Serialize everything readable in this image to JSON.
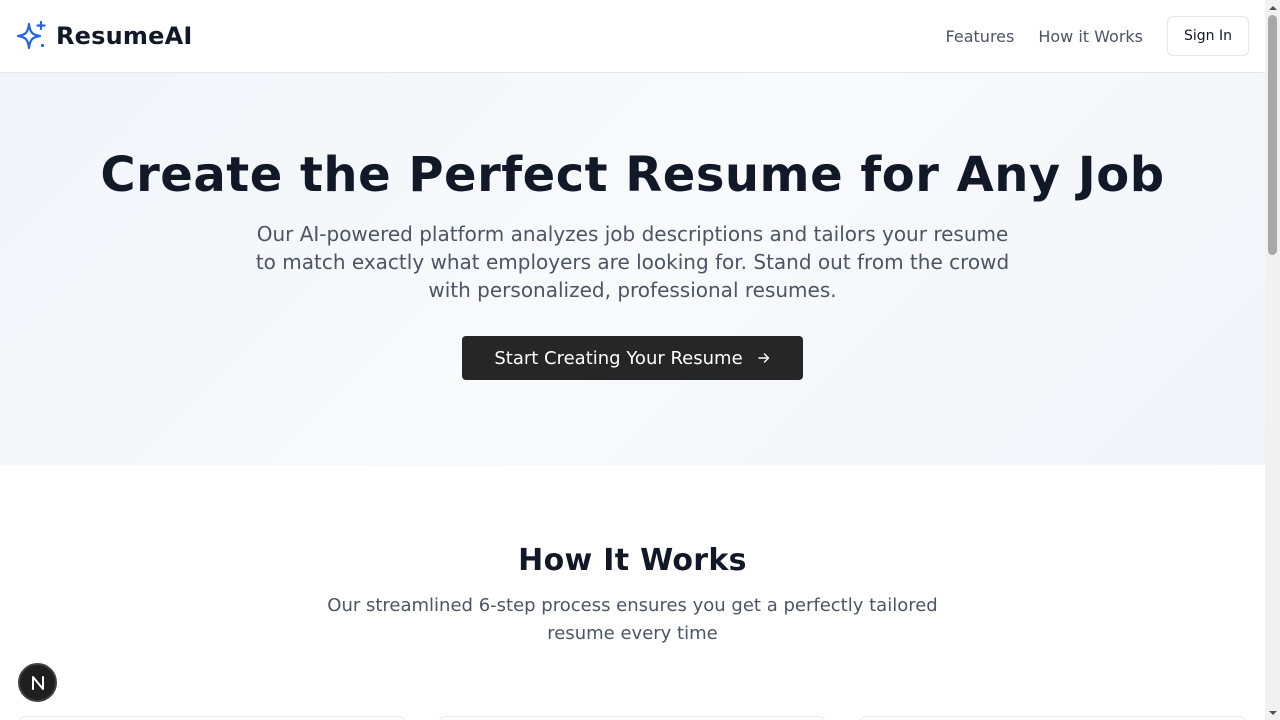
{
  "header": {
    "brand_name": "ResumeAI",
    "brand_icon": "sparkles-icon",
    "nav": [
      {
        "label": "Features"
      },
      {
        "label": "How it Works"
      }
    ],
    "signin_label": "Sign In"
  },
  "hero": {
    "title": "Create the Perfect Resume for Any Job",
    "subtitle": "Our AI-powered platform analyzes job descriptions and tailors your resume to match exactly what employers are looking for. Stand out from the crowd with personalized, professional resumes.",
    "cta_label": "Start Creating Your Resume",
    "cta_icon": "arrow-right-icon"
  },
  "how_it_works": {
    "title": "How It Works",
    "subtitle": "Our streamlined 6-step process ensures you get a perfectly tailored resume every time"
  },
  "colors": {
    "brand_accent": "#2563eb",
    "cta_background": "#262626",
    "hero_background": "#f1f5f9",
    "heading_text": "#111827",
    "body_text": "#4b5563"
  },
  "badge": {
    "icon": "n-logo-icon"
  }
}
